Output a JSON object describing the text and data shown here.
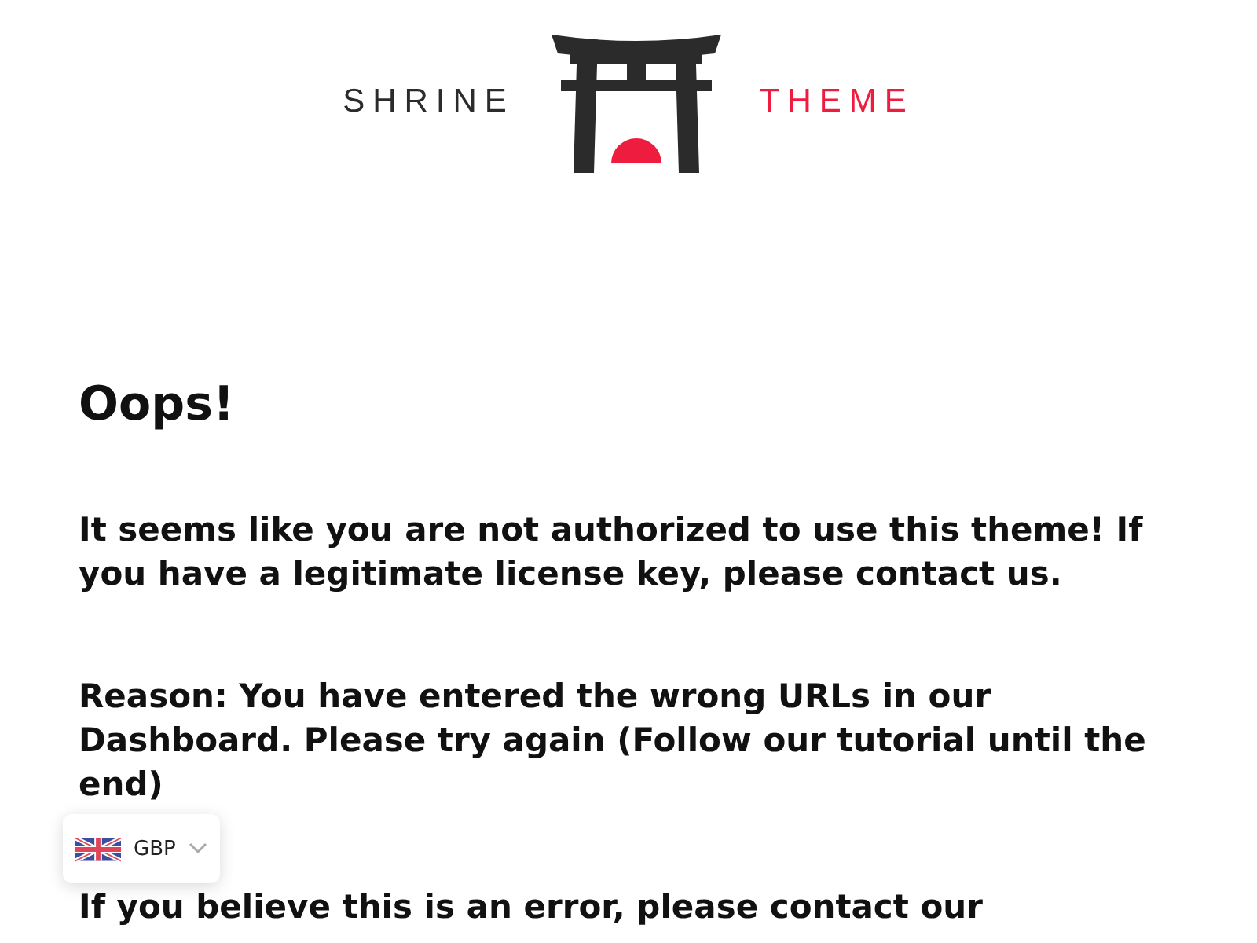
{
  "logo": {
    "left_word": "SHRINE",
    "right_word": "THEME"
  },
  "heading": "Oops!",
  "paragraphs": [
    "It seems like you are not authorized to use this theme! If you have a legitimate license key, please contact us.",
    "Reason: You have entered the wrong URLs in our Dashboard. Please try again (Follow our tutorial until the end)",
    "If you believe this is an error, please contact our"
  ],
  "currency": {
    "code": "GBP"
  }
}
